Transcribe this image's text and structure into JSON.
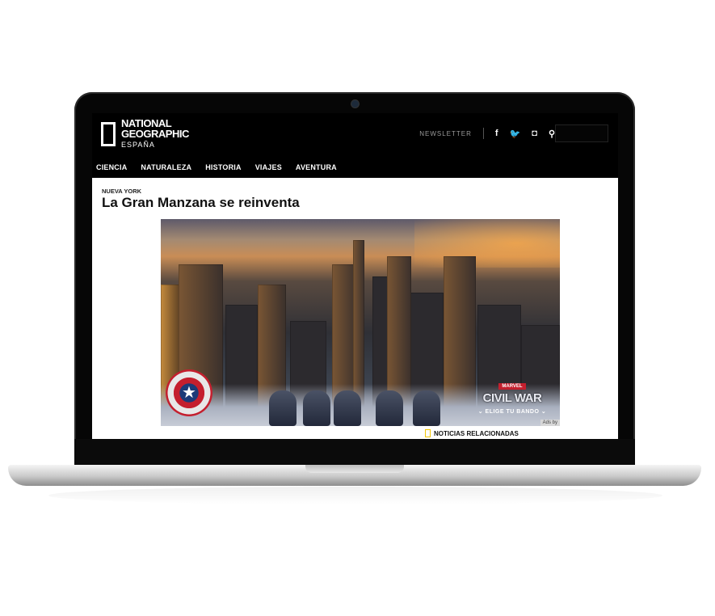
{
  "site": {
    "logo": {
      "line1": "NATIONAL",
      "line2": "GEOGRAPHIC",
      "line3": "ESPAÑA"
    },
    "newsletter": "NEWSLETTER",
    "social": {
      "facebook": "f",
      "twitter": "🐦",
      "instagram": "◘",
      "search": "⚲"
    }
  },
  "nav": [
    "CIENCIA",
    "NATURALEZA",
    "HISTORIA",
    "VIAJES",
    "AVENTURA"
  ],
  "article": {
    "kicker": "NUEVA YORK",
    "headline": "La Gran Manzana se reinventa"
  },
  "ad": {
    "brand_small": "MARVEL",
    "title": "CIVIL WAR",
    "cta": "⌄ ELIGE TU BANDO ⌄",
    "adsby": "Ads by"
  },
  "related": {
    "label": "NOTICIAS RELACIONADAS"
  },
  "colors": {
    "header_bg": "#000000",
    "accent_yellow": "#f2c500"
  }
}
